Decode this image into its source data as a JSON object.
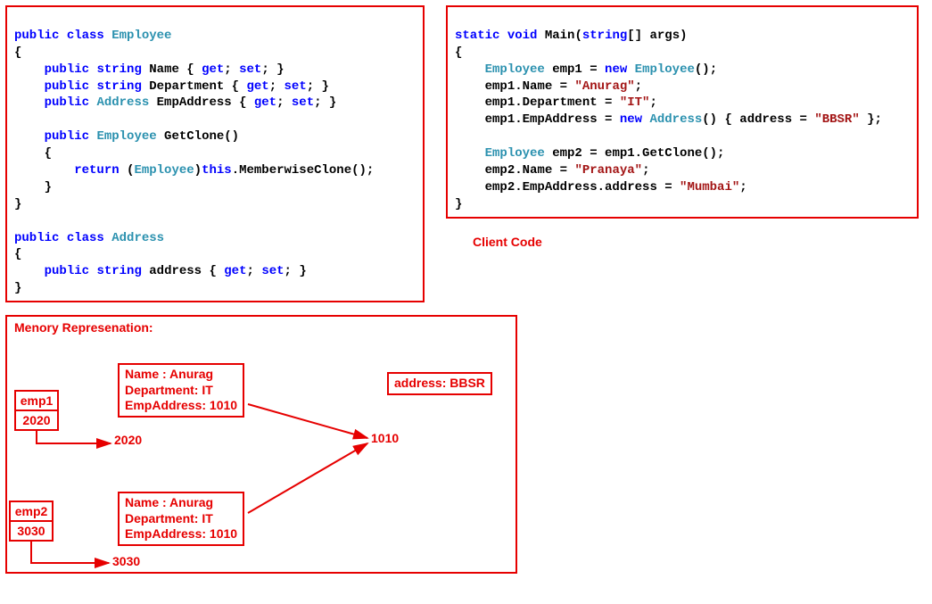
{
  "code_left": {
    "l1a": "public",
    "l1b": "class",
    "l1c": "Employee",
    "l2": "{",
    "l3a": "public",
    "l3b": "string",
    "l3c": " Name { ",
    "l3d": "get",
    "l3e": "; ",
    "l3f": "set",
    "l3g": "; }",
    "l4a": "public",
    "l4b": "string",
    "l4c": " Department { ",
    "l4d": "get",
    "l4e": "; ",
    "l4f": "set",
    "l4g": "; }",
    "l5a": "public",
    "l5b": "Address",
    "l5c": " EmpAddress { ",
    "l5d": "get",
    "l5e": "; ",
    "l5f": "set",
    "l5g": "; }",
    "l6a": "public",
    "l6b": "Employee",
    "l6c": " GetClone()",
    "l7": "{",
    "l8a": "return",
    "l8b": " (",
    "l8c": "Employee",
    "l8d": ")",
    "l8e": "this",
    "l8f": ".MemberwiseClone();",
    "l9": "}",
    "l10": "}",
    "l11a": "public",
    "l11b": "class",
    "l11c": "Address",
    "l12": "{",
    "l13a": "public",
    "l13b": "string",
    "l13c": " address { ",
    "l13d": "get",
    "l13e": "; ",
    "l13f": "set",
    "l13g": "; }",
    "l14": "}"
  },
  "code_right": {
    "r1a": "static",
    "r1b": "void",
    "r1c": " Main(",
    "r1d": "string",
    "r1e": "[] args)",
    "r2": "{",
    "r3a": "Employee",
    "r3b": " emp1 = ",
    "r3c": "new",
    "r3d": "Employee",
    "r3e": "();",
    "r4a": "emp1.Name = ",
    "r4b": "\"Anurag\"",
    "r4c": ";",
    "r5a": "emp1.Department = ",
    "r5b": "\"IT\"",
    "r5c": ";",
    "r6a": "emp1.EmpAddress = ",
    "r6b": "new",
    "r6c": "Address",
    "r6d": "() { address = ",
    "r6e": "\"BBSR\"",
    "r6f": " };",
    "r7a": "Employee",
    "r7b": " emp2 = emp1.GetClone();",
    "r8a": "emp2.Name = ",
    "r8b": "\"Pranaya\"",
    "r8c": ";",
    "r9a": "emp2.EmpAddress.address = ",
    "r9b": "\"Mumbai\"",
    "r9c": ";",
    "r10": "}"
  },
  "client_label": "Client Code",
  "memory": {
    "title": "Menory Represenation:",
    "emp1_label": "emp1",
    "emp1_addr": "2020",
    "emp2_label": "emp2",
    "emp2_addr": "3030",
    "obj1": "Name : Anurag\nDepartment: IT\nEmpAddress: 1010",
    "obj2": "Name : Anurag\nDepartment: IT\nEmpAddress: 1010",
    "addr_box": "address: BBSR",
    "ptr2020": "2020",
    "ptr3030": "3030",
    "ptr1010": "1010"
  }
}
